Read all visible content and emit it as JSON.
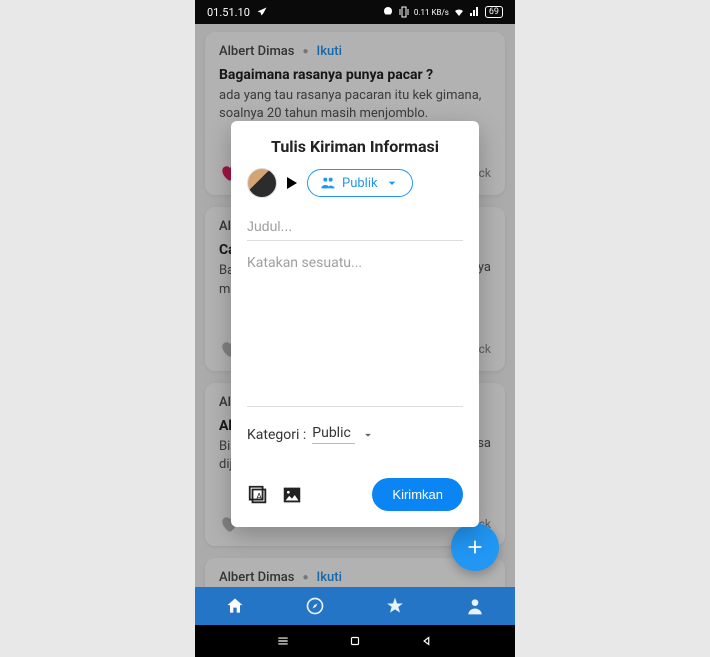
{
  "status_bar": {
    "time": "01.51.10",
    "battery": "69",
    "net_speed": "0.11 KB/s"
  },
  "feed": {
    "posts": [
      {
        "author": "Albert Dimas",
        "follow": "Ikuti",
        "title": "Bagaimana rasanya punya pacar ?",
        "body": "ada yang tau rasanya pacaran itu kek gimana, soalnya 20 tahun masih menjomblo.",
        "action_right": "ick",
        "liked": true
      },
      {
        "author": "Alb",
        "follow": "",
        "title": "Ca",
        "body": "Ba\nma",
        "action_right": "ick",
        "liked": false,
        "trail": "nya"
      },
      {
        "author": "Alb",
        "follow": "",
        "title": "Ak",
        "body": "Bin\ndije",
        "action_right": "ick",
        "liked": false,
        "trail": "isa"
      },
      {
        "author": "Albert Dimas",
        "follow": "Ikuti",
        "title": "",
        "body": "",
        "action_right": ""
      }
    ]
  },
  "modal": {
    "title": "Tulis Kiriman Informasi",
    "audience_label": "Publik",
    "title_placeholder": "Judul...",
    "body_placeholder": "Katakan sesuatu...",
    "category_label": "Kategori :",
    "category_value": "Public",
    "submit_label": "Kirimkan"
  }
}
